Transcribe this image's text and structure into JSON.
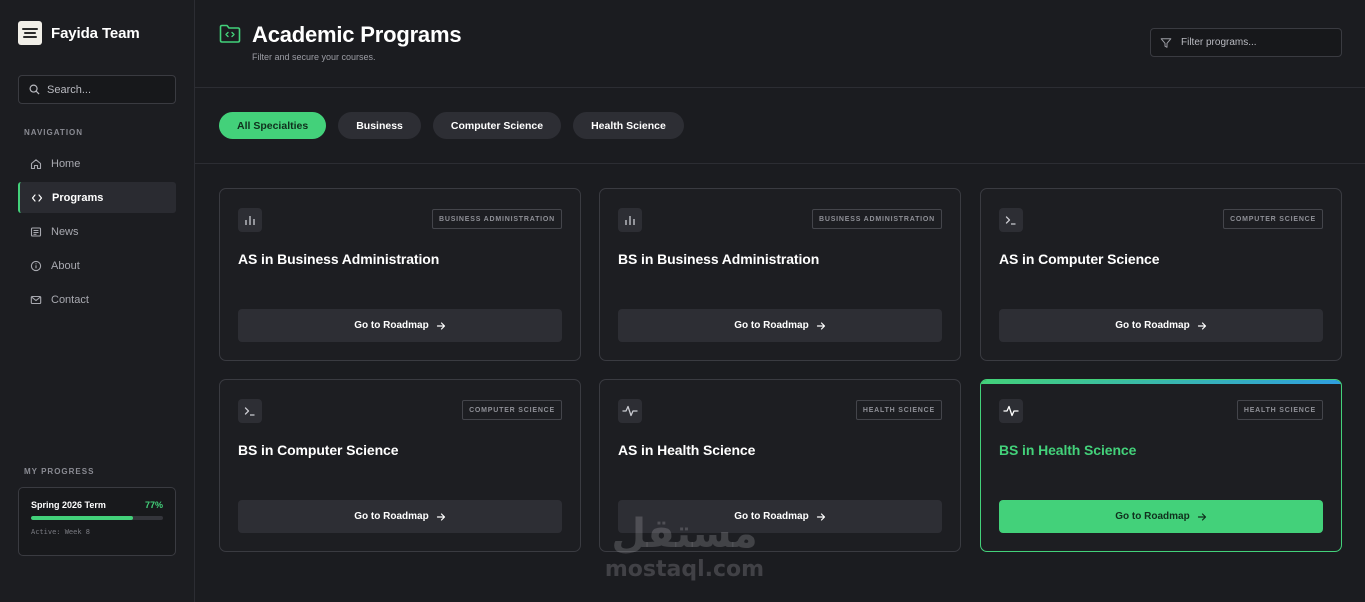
{
  "sidebar": {
    "brand": "Fayida Team",
    "search_placeholder": "Search...",
    "nav_title": "NAVIGATION",
    "items": [
      {
        "label": "Home",
        "icon": "home-icon",
        "active": false
      },
      {
        "label": "Programs",
        "icon": "code-icon",
        "active": true
      },
      {
        "label": "News",
        "icon": "news-icon",
        "active": false
      },
      {
        "label": "About",
        "icon": "info-icon",
        "active": false
      },
      {
        "label": "Contact",
        "icon": "mail-icon",
        "active": false
      }
    ],
    "progress_title": "MY PROGRESS",
    "progress": {
      "term": "Spring 2026 Term",
      "percent_label": "77%",
      "percent": 77,
      "status": "Active: Week 8"
    }
  },
  "header": {
    "title": "Academic Programs",
    "subtitle": "Filter and secure your courses.",
    "filter_placeholder": "Filter programs..."
  },
  "chips": [
    {
      "label": "All Specialties",
      "active": true
    },
    {
      "label": "Business",
      "active": false
    },
    {
      "label": "Computer Science",
      "active": false
    },
    {
      "label": "Health Science",
      "active": false
    }
  ],
  "cards": [
    {
      "title": "AS in Business Administration",
      "badge": "BUSINESS ADMINISTRATION",
      "icon": "bar-chart-icon",
      "button": "Go to Roadmap"
    },
    {
      "title": "BS in Business Administration",
      "badge": "BUSINESS ADMINISTRATION",
      "icon": "bar-chart-icon",
      "button": "Go to Roadmap"
    },
    {
      "title": "AS in Computer Science",
      "badge": "COMPUTER SCIENCE",
      "icon": "terminal-icon",
      "button": "Go to Roadmap"
    },
    {
      "title": "BS in Computer Science",
      "badge": "COMPUTER SCIENCE",
      "icon": "terminal-icon",
      "button": "Go to Roadmap"
    },
    {
      "title": "AS in Health Science",
      "badge": "HEALTH SCIENCE",
      "icon": "pulse-icon",
      "button": "Go to Roadmap"
    },
    {
      "title": "BS in Health Science",
      "badge": "HEALTH SCIENCE",
      "icon": "pulse-icon",
      "button": "Go to Roadmap",
      "highlighted": true
    }
  ],
  "watermark": {
    "arabic": "مستقل",
    "latin": "mostaql.com"
  },
  "colors": {
    "accent": "#43d17a",
    "background": "#1b1c20",
    "card": "#1d1e22",
    "chip": "#2d2e34",
    "gradient_end": "#2f9fe0"
  }
}
